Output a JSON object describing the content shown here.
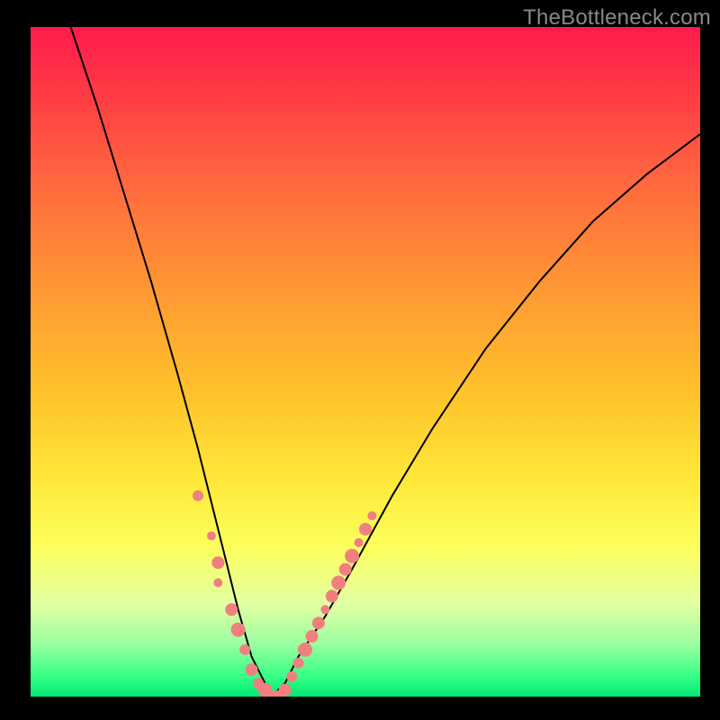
{
  "watermark": "TheBottleneck.com",
  "chart_data": {
    "type": "line",
    "title": "",
    "xlabel": "",
    "ylabel": "",
    "xlim": [
      0,
      100
    ],
    "ylim": [
      0,
      100
    ],
    "background_gradient": {
      "top_color": "#ff1a4d",
      "bottom_color": "#00e874",
      "meaning": "red=high bottleneck, green=no bottleneck"
    },
    "series": [
      {
        "name": "bottleneck-curve",
        "color": "#000000",
        "x": [
          6,
          10,
          14,
          18,
          22,
          25,
          27,
          29,
          31,
          33,
          35,
          36,
          38,
          40,
          44,
          48,
          54,
          60,
          68,
          76,
          84,
          92,
          100
        ],
        "values": [
          100,
          88,
          75,
          62,
          48,
          37,
          29,
          21,
          13,
          6,
          2,
          0,
          2,
          6,
          12,
          19,
          30,
          40,
          52,
          62,
          71,
          78,
          84
        ]
      }
    ],
    "markers": [
      {
        "name": "curve-dots-left",
        "color": "#f08080",
        "shape": "circle",
        "points": [
          {
            "x": 25,
            "y": 30,
            "r": 6
          },
          {
            "x": 27,
            "y": 24,
            "r": 5
          },
          {
            "x": 28,
            "y": 20,
            "r": 7
          },
          {
            "x": 28,
            "y": 17,
            "r": 5
          },
          {
            "x": 30,
            "y": 13,
            "r": 7
          },
          {
            "x": 31,
            "y": 10,
            "r": 8
          },
          {
            "x": 32,
            "y": 7,
            "r": 6
          },
          {
            "x": 33,
            "y": 4,
            "r": 7
          },
          {
            "x": 34,
            "y": 2,
            "r": 6
          },
          {
            "x": 35,
            "y": 1,
            "r": 7
          },
          {
            "x": 35,
            "y": 1,
            "r": 8
          },
          {
            "x": 36,
            "y": 0,
            "r": 7
          },
          {
            "x": 37,
            "y": 0,
            "r": 7
          },
          {
            "x": 38,
            "y": 1,
            "r": 7
          }
        ]
      },
      {
        "name": "curve-dots-right",
        "color": "#f08080",
        "shape": "circle",
        "points": [
          {
            "x": 39,
            "y": 3,
            "r": 6
          },
          {
            "x": 40,
            "y": 5,
            "r": 6
          },
          {
            "x": 41,
            "y": 7,
            "r": 8
          },
          {
            "x": 42,
            "y": 9,
            "r": 7
          },
          {
            "x": 43,
            "y": 11,
            "r": 7
          },
          {
            "x": 44,
            "y": 13,
            "r": 5
          },
          {
            "x": 45,
            "y": 15,
            "r": 7
          },
          {
            "x": 46,
            "y": 17,
            "r": 8
          },
          {
            "x": 47,
            "y": 19,
            "r": 7
          },
          {
            "x": 48,
            "y": 21,
            "r": 8
          },
          {
            "x": 49,
            "y": 23,
            "r": 5
          },
          {
            "x": 50,
            "y": 25,
            "r": 7
          },
          {
            "x": 51,
            "y": 27,
            "r": 5
          }
        ]
      }
    ]
  }
}
